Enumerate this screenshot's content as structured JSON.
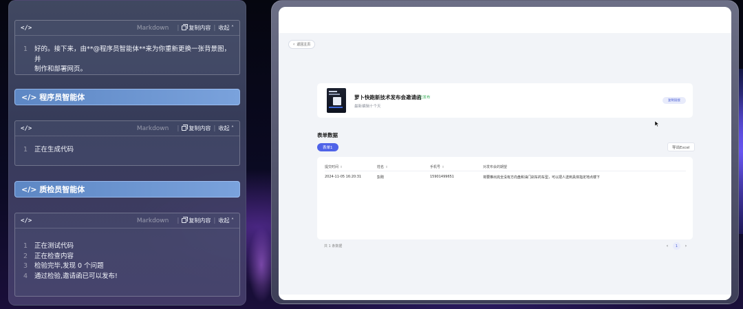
{
  "chat": {
    "cards": [
      {
        "tag": "</>",
        "lang": "Markdown",
        "copy_label": "复制内容",
        "collapse_label": "收起",
        "lines": [
          {
            "num": "1",
            "text": "好的。接下来，由**@程序员智能体**来为你重新更换一张背景图，并"
          },
          {
            "num": "",
            "text": "制作和部署网页。"
          }
        ]
      },
      {
        "tag": "</>",
        "lang": "Markdown",
        "copy_label": "复制内容",
        "collapse_label": "收起",
        "lines": [
          {
            "num": "1",
            "text": "正在生成代码"
          }
        ]
      },
      {
        "tag": "</>",
        "lang": "Markdown",
        "copy_label": "复制内容",
        "collapse_label": "收起",
        "lines": [
          {
            "num": "1",
            "text": "正在测试代码"
          },
          {
            "num": "2",
            "text": "正在检查内容"
          },
          {
            "num": "3",
            "text": "检验完毕,发现 0 个问题"
          },
          {
            "num": "4",
            "text": "通过检验,邀请函已可以发布!"
          }
        ]
      }
    ],
    "agents": [
      {
        "label": "</> 程序员智能体"
      },
      {
        "label": "</> 质检员智能体"
      }
    ]
  },
  "browser": {
    "back_label": "返回主页",
    "event": {
      "title": "萝卜快跑新技术发布会邀请函",
      "status": "已发布",
      "subtitle": "最新编辑十个天",
      "copy_link_label": "复制链接"
    },
    "form_section_title": "表单数据",
    "sheet_tab": "表单1",
    "export_label": "导出Excel",
    "table": {
      "columns": [
        "提交时间",
        "姓名",
        "手机号",
        "对发布会的期望"
      ],
      "rows": [
        [
          "2024-11-05 16:20:31",
          "彭刚",
          "15901499651",
          "将要推出完全没有方向盘和油门刹车的车型，可以把人送到具体指定地点楼下"
        ]
      ]
    },
    "total_text": "共 1 条数据",
    "pagination": {
      "current": "1"
    }
  },
  "colors": {
    "accent": "#4f63e8",
    "status_green": "#3aae5a",
    "agent_bar": "#6b95d0"
  }
}
